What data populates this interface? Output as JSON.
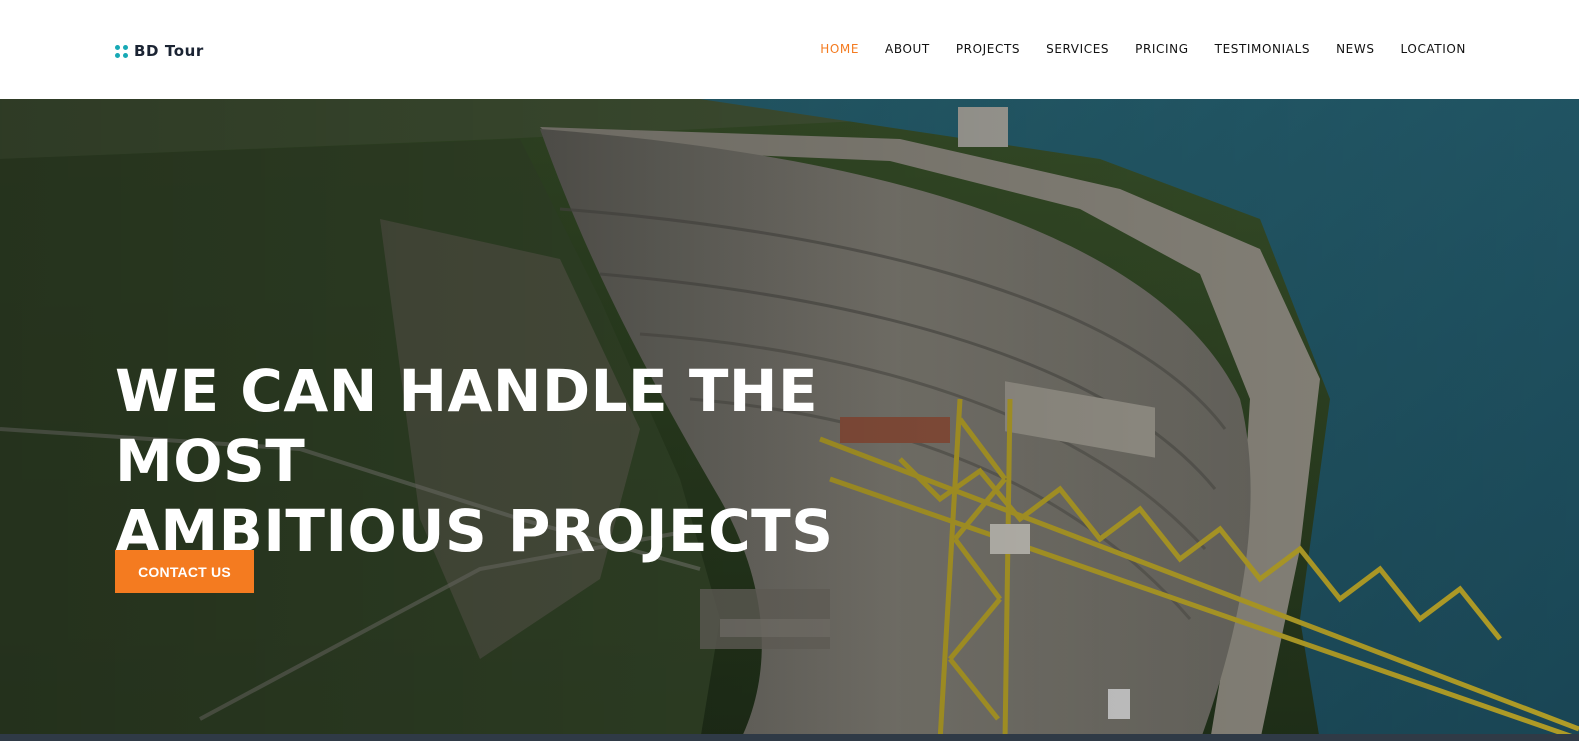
{
  "brand": {
    "name": "BD Tour",
    "icon": "four-dot-logo-icon",
    "dot_color": "#17a9b5"
  },
  "nav": {
    "items": [
      {
        "label": "HOME",
        "active": true
      },
      {
        "label": "ABOUT",
        "active": false
      },
      {
        "label": "PROJECTS",
        "active": false
      },
      {
        "label": "SERVICES",
        "active": false
      },
      {
        "label": "PRICING",
        "active": false
      },
      {
        "label": "TESTIMONIALS",
        "active": false
      },
      {
        "label": "NEWS",
        "active": false
      },
      {
        "label": "LOCATION",
        "active": false
      }
    ],
    "active_color": "#f47b20"
  },
  "hero": {
    "title_line1": "WE CAN HANDLE THE MOST",
    "title_line2": "AMBITIOUS PROJECTS",
    "cta_label": "CONTACT US",
    "cta_color": "#f47b20",
    "background": "dam-with-crane-photo"
  }
}
